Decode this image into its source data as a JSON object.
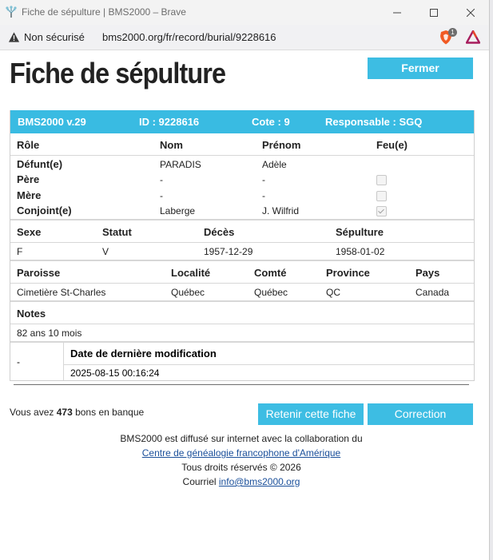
{
  "browser": {
    "tab_title": "Fiche de sépulture | BMS2000 – Brave",
    "security_label": "Non sécurisé",
    "url": "bms2000.org/fr/record/burial/9228616",
    "shield_count": "1"
  },
  "page": {
    "title": "Fiche de sépulture",
    "close_label": "Fermer"
  },
  "record": {
    "header": {
      "version": "BMS2000 v.29",
      "id": "ID : 9228616",
      "cote": "Cote : 9",
      "responsable": "Responsable : SGQ"
    },
    "persons": {
      "columns": [
        "Rôle",
        "Nom",
        "Prénom",
        "Feu(e)"
      ],
      "rows": [
        {
          "role": "Défunt(e)",
          "nom": "PARADIS",
          "prenom": "Adèle",
          "feu": null
        },
        {
          "role": "Père",
          "nom": "-",
          "prenom": "-",
          "feu": false
        },
        {
          "role": "Mère",
          "nom": "-",
          "prenom": "-",
          "feu": false
        },
        {
          "role": "Conjoint(e)",
          "nom": "Laberge",
          "prenom": "J. Wilfrid",
          "feu": true
        }
      ]
    },
    "vitals": {
      "columns": [
        "Sexe",
        "Statut",
        "Décès",
        "Sépulture"
      ],
      "values": [
        "F",
        "V",
        "1957-12-29",
        "1958-01-02"
      ]
    },
    "place": {
      "columns": [
        "Paroisse",
        "Localité",
        "Comté",
        "Province",
        "Pays"
      ],
      "values": [
        "Cimetière St-Charles",
        "Québec",
        "Québec",
        "QC",
        "Canada"
      ]
    },
    "notes": {
      "label": "Notes",
      "value": "82 ans 10 mois"
    },
    "modification": {
      "left_value": "-",
      "label": "Date de dernière modification",
      "value": "2025-08-15 00:16:24"
    }
  },
  "bank": {
    "prefix": "Vous avez ",
    "count": "473",
    "suffix": " bons en banque"
  },
  "actions": {
    "keep_label": "Retenir cette fiche",
    "correction_label": "Correction"
  },
  "footer": {
    "line1": "BMS2000 est diffusé sur internet avec la collaboration du",
    "link": "Centre de généalogie francophone d'Amérique",
    "rights": "Tous droits réservés © 2026",
    "mail_prefix": "Courriel ",
    "mail": "info@bms2000.org"
  }
}
